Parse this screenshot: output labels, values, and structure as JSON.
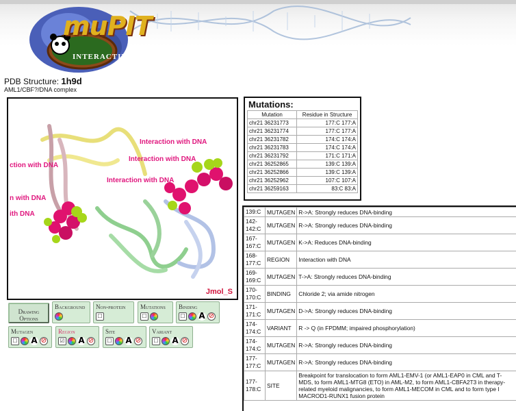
{
  "header": {
    "logo_text": "muPIT",
    "logo_subtext": "INTERACTIVE"
  },
  "structure": {
    "label": "PDB Structure:",
    "id": "1h9d",
    "description": "AML1/CBF?/DNA complex"
  },
  "viewer": {
    "labels": [
      "Interaction with DNA",
      "Interaction with DNA",
      "Interaction with DNA",
      "ction with DNA",
      "n with DNA",
      "ith DNA"
    ],
    "watermark": "Jmol_S"
  },
  "controls": {
    "drawing_options": "Drawing Options",
    "background": "Background",
    "non_protein": "Non-protein",
    "mutations": "Mutations",
    "binding": "Binding",
    "mutagen": "Mutagen",
    "region": "Region",
    "site": "Site",
    "variant": "Variant"
  },
  "mutations": {
    "title": "Mutations:",
    "headers": [
      "Mutation",
      "Residue in Structure"
    ],
    "rows": [
      [
        "chr21 36231773",
        "177:C 177:A"
      ],
      [
        "chr21 36231774",
        "177:C 177:A"
      ],
      [
        "chr21 36231782",
        "174:C 174:A"
      ],
      [
        "chr21 36231783",
        "174:C 174:A"
      ],
      [
        "chr21 36231792",
        "171:C 171:A"
      ],
      [
        "chr21 36252865",
        "139:C 139:A"
      ],
      [
        "chr21 36252866",
        "139:C 139:A"
      ],
      [
        "chr21 36252962",
        "107:C 107:A"
      ],
      [
        "chr21 36259163",
        "83:C 83:A"
      ]
    ]
  },
  "features": [
    [
      "139:C",
      "MUTAGEN",
      "R->A: Strongly reduces DNA-binding"
    ],
    [
      "142-\n142:C",
      "MUTAGEN",
      "R->A: Strongly reduces DNA-binding"
    ],
    [
      "167-\n167:C",
      "MUTAGEN",
      "K->A: Reduces DNA-binding"
    ],
    [
      "168-\n177:C",
      "REGION",
      "Interaction with DNA"
    ],
    [
      "169-\n169:C",
      "MUTAGEN",
      "T->A: Strongly reduces DNA-binding"
    ],
    [
      "170-\n170:C",
      "BINDING",
      "Chloride 2; via amide nitrogen"
    ],
    [
      "171-\n171:C",
      "MUTAGEN",
      "D->A: Strongly reduces DNA-binding"
    ],
    [
      "174-\n174:C",
      "VARIANT",
      "R -> Q (in FPDMM; impaired phosphorylation)"
    ],
    [
      "174-\n174:C",
      "MUTAGEN",
      "R->A: Strongly reduces DNA-binding"
    ],
    [
      "177-\n177:C",
      "MUTAGEN",
      "R->A: Strongly reduces DNA-binding"
    ],
    [
      "177-\n178:C",
      "SITE",
      "Breakpoint for translocation to form AML1-EMV-1 (or AML1-EAP0 in CML and T- MDS, to form AML1-MTG8 (ETO) in AML-M2, to form AML1-CBFA2T3 in therapy-related myeloid malignancies, to form AML1-MECOM in CML and to form type I MACROD1-RUNX1 fusion protein"
    ]
  ]
}
